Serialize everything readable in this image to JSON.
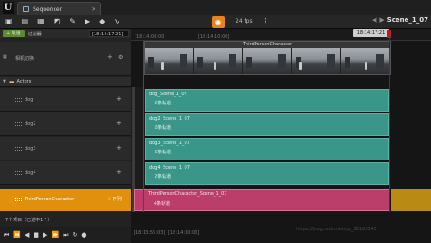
{
  "window": {
    "logo": "U",
    "tab_title": "Sequencer",
    "tab_close": "×"
  },
  "toolbar": {
    "fps": "24 fps",
    "scene_name": "Scene_1_07",
    "icons": [
      "save-icon",
      "folder-icon",
      "film-icon",
      "camera-clapper-icon",
      "wrench-icon",
      "play-icon",
      "key-diamond-icon",
      "curve-icon",
      "camera-icon",
      "graph-icon"
    ]
  },
  "left": {
    "add_track": "+ 轨道",
    "filter": "过滤器",
    "timecode": "[18:14:17:21]",
    "camera_cut": "相机切换",
    "actors": "Actors",
    "tracks": [
      {
        "label": "dog"
      },
      {
        "label": "dog2"
      },
      {
        "label": "dog3"
      },
      {
        "label": "dog4"
      }
    ],
    "character": "ThirdPersonCharacter",
    "character_add": "+ 序列",
    "status": "7个项目（已选中1个）"
  },
  "timeline": {
    "current": "[18:14:17:21]",
    "ticks": [
      "[18:14:08:00]",
      "[18:14:10:00]"
    ],
    "camera_clip_label": "ThirdPersonCharacter",
    "bottom_ticks": [
      "[18:13:59:03]",
      "[18:14:00:00]"
    ]
  },
  "clips": [
    {
      "title": "dog_Scene_1_07",
      "sub": "2条轨道"
    },
    {
      "title": "dog2_Scene_1_07",
      "sub": "2条轨道"
    },
    {
      "title": "dog3_Scene_1_07",
      "sub": "2条轨道"
    },
    {
      "title": "dog4_Scene_1_07",
      "sub": "2条轨道"
    }
  ],
  "character_clip": {
    "title": "ThirdPersonCharacter_Scene_1_07",
    "sub": "4条轨道"
  },
  "watermark": "https://blog.csdn.net/qq_33182045",
  "colors": {
    "accent": "#e1900e",
    "clip": "#3a9688",
    "char_clip": "#bb3d6a",
    "add": "#5a8a32",
    "playhead": "#b32020"
  }
}
